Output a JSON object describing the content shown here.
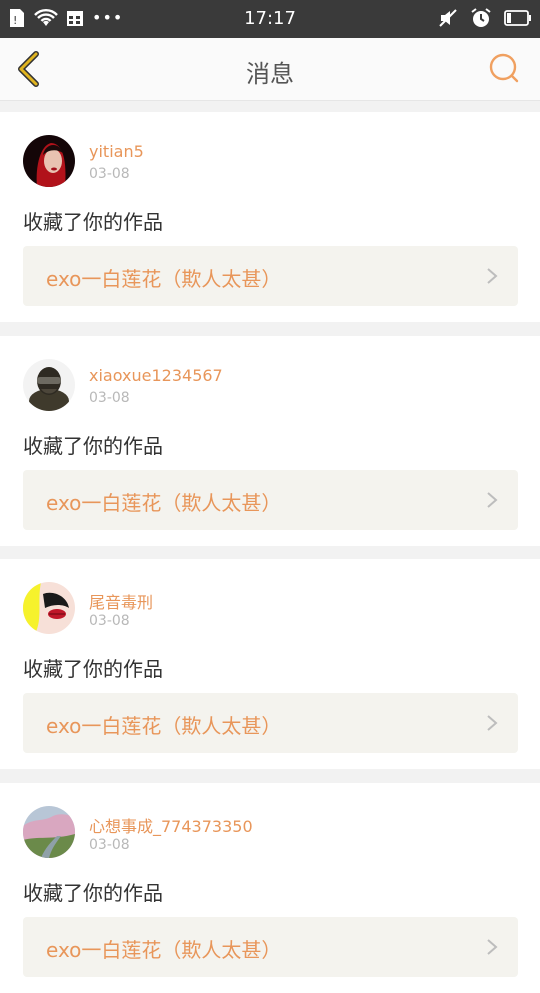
{
  "status_bar": {
    "time": "17:17",
    "left_icons": [
      "sim-icon",
      "wifi-icon",
      "calendar-icon"
    ],
    "dots": "•••",
    "right_icons": [
      "mute-icon",
      "alarm-icon",
      "battery-icon"
    ]
  },
  "header": {
    "title": "消息",
    "back_icon": "chevron-left-icon",
    "search_icon": "search-icon"
  },
  "messages": [
    {
      "username": "yitian5",
      "date": "03-08",
      "action": "收藏了你的作品",
      "work_title": "exo一白莲花（欺人太甚）"
    },
    {
      "username": "xiaoxue1234567",
      "date": "03-08",
      "action": "收藏了你的作品",
      "work_title": "exo一白莲花（欺人太甚）"
    },
    {
      "username": "尾音毒刑",
      "date": "03-08",
      "action": "收藏了你的作品",
      "work_title": "exo一白莲花（欺人太甚）"
    },
    {
      "username": "心想事成_774373350",
      "date": "03-08",
      "action": "收藏了你的作品",
      "work_title": "exo一白莲花（欺人太甚）"
    }
  ],
  "colors": {
    "accent": "#e8965a",
    "back_accent": "#e0b420",
    "status_bar": "#3a3a3a"
  }
}
